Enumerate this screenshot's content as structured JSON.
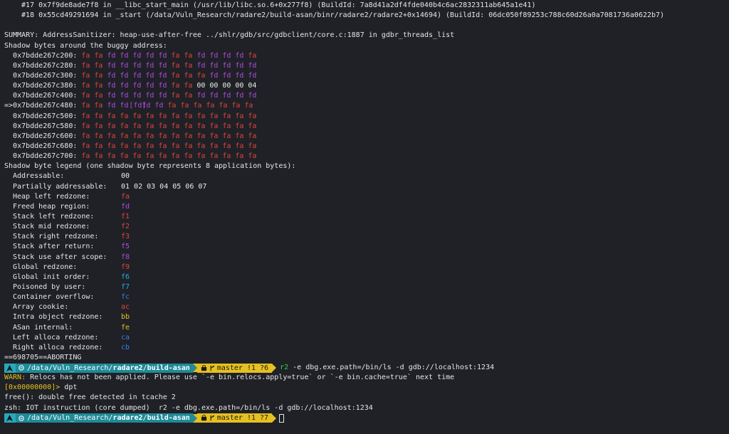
{
  "colors": {
    "background": "#1f2126",
    "heap_redzone": "#e0443e",
    "freed": "#b04be0",
    "prompt_os": "#2aa8b8",
    "prompt_path": "#1f8a98",
    "prompt_git": "#e6c020",
    "cmd_green": "#3fcf5a"
  },
  "backtrace": [
    "#17 0x7f9de8ade7f8 in __libc_start_main (/usr/lib/libc.so.6+0x277f8) (BuildId: 7a8d41a2df4fde040b4c6ac2832311ab645a1e41)",
    "#18 0x55cd49291694 in _start (/data/Vuln_Research/radare2/build-asan/binr/radare2/radare2+0x14694) (BuildId: 06dc050f89253c788c60d26a0a7081736a0622b7)"
  ],
  "summary": "SUMMARY: AddressSanitizer: heap-use-after-free ../shlr/gdb/src/gdbclient/core.c:1887 in gdbr_threads_list",
  "shadow_header": "Shadow bytes around the buggy address:",
  "shadow_rows": [
    {
      "prefix": "  ",
      "addr": "0x7bdde267c200:",
      "bytes": [
        "fa",
        "fa",
        "fd",
        "fd",
        "fd",
        "fd",
        "fd",
        "fa",
        "fa",
        "fd",
        "fd",
        "fd",
        "fd",
        "fa"
      ]
    },
    {
      "prefix": "  ",
      "addr": "0x7bdde267c280:",
      "bytes": [
        "fa",
        "fa",
        "fd",
        "fd",
        "fd",
        "fd",
        "fd",
        "fa",
        "fa",
        "fd",
        "fd",
        "fd",
        "fd",
        "fd"
      ]
    },
    {
      "prefix": "  ",
      "addr": "0x7bdde267c300:",
      "bytes": [
        "fa",
        "fa",
        "fd",
        "fd",
        "fd",
        "fd",
        "fd",
        "fa",
        "fa",
        "fa",
        "fd",
        "fd",
        "fd",
        "fd"
      ]
    },
    {
      "prefix": "  ",
      "addr": "0x7bdde267c380:",
      "bytes": [
        "fa",
        "fa",
        "fd",
        "fd",
        "fd",
        "fd",
        "fd",
        "fa",
        "fa",
        "00",
        "00",
        "00",
        "00",
        "04"
      ]
    },
    {
      "prefix": "  ",
      "addr": "0x7bdde267c400:",
      "bytes": [
        "fa",
        "fa",
        "fd",
        "fd",
        "fd",
        "fd",
        "fd",
        "fa",
        "fa",
        "fd",
        "fd",
        "fd",
        "fd",
        "fd"
      ]
    },
    {
      "prefix": "=>",
      "addr": "0x7bdde267c480:",
      "bytes": [
        "fa",
        "fa",
        "fd",
        "fd",
        "[fd]",
        "fd",
        "fd",
        "fa",
        "fa",
        "fa",
        "fa",
        "fa",
        "fa",
        "fa"
      ]
    },
    {
      "prefix": "  ",
      "addr": "0x7bdde267c500:",
      "bytes": [
        "fa",
        "fa",
        "fa",
        "fa",
        "fa",
        "fa",
        "fa",
        "fa",
        "fa",
        "fa",
        "fa",
        "fa",
        "fa",
        "fa"
      ]
    },
    {
      "prefix": "  ",
      "addr": "0x7bdde267c580:",
      "bytes": [
        "fa",
        "fa",
        "fa",
        "fa",
        "fa",
        "fa",
        "fa",
        "fa",
        "fa",
        "fa",
        "fa",
        "fa",
        "fa",
        "fa"
      ]
    },
    {
      "prefix": "  ",
      "addr": "0x7bdde267c600:",
      "bytes": [
        "fa",
        "fa",
        "fa",
        "fa",
        "fa",
        "fa",
        "fa",
        "fa",
        "fa",
        "fa",
        "fa",
        "fa",
        "fa",
        "fa"
      ]
    },
    {
      "prefix": "  ",
      "addr": "0x7bdde267c680:",
      "bytes": [
        "fa",
        "fa",
        "fa",
        "fa",
        "fa",
        "fa",
        "fa",
        "fa",
        "fa",
        "fa",
        "fa",
        "fa",
        "fa",
        "fa"
      ]
    },
    {
      "prefix": "  ",
      "addr": "0x7bdde267c700:",
      "bytes": [
        "fa",
        "fa",
        "fa",
        "fa",
        "fa",
        "fa",
        "fa",
        "fa",
        "fa",
        "fa",
        "fa",
        "fa",
        "fa",
        "fa"
      ]
    }
  ],
  "legend_header": "Shadow byte legend (one shadow byte represents 8 application bytes):",
  "legend": [
    {
      "label": "Addressable:",
      "value": "00",
      "cls": "c-00"
    },
    {
      "label": "Partially addressable:",
      "value": "01 02 03 04 05 06 07",
      "cls": "c-00"
    },
    {
      "label": "Heap left redzone:",
      "value": "fa",
      "cls": "c-fa"
    },
    {
      "label": "Freed heap region:",
      "value": "fd",
      "cls": "c-fd"
    },
    {
      "label": "Stack left redzone:",
      "value": "f1",
      "cls": "c-f1"
    },
    {
      "label": "Stack mid redzone:",
      "value": "f2",
      "cls": "c-f1"
    },
    {
      "label": "Stack right redzone:",
      "value": "f3",
      "cls": "c-f1"
    },
    {
      "label": "Stack after return:",
      "value": "f5",
      "cls": "c-f5"
    },
    {
      "label": "Stack use after scope:",
      "value": "f8",
      "cls": "c-f5"
    },
    {
      "label": "Global redzone:",
      "value": "f9",
      "cls": "c-f1"
    },
    {
      "label": "Global init order:",
      "value": "f6",
      "cls": "c-f6"
    },
    {
      "label": "Poisoned by user:",
      "value": "f7",
      "cls": "c-f7"
    },
    {
      "label": "Container overflow:",
      "value": "fc",
      "cls": "c-fc"
    },
    {
      "label": "Array cookie:",
      "value": "ac",
      "cls": "c-ac"
    },
    {
      "label": "Intra object redzone:",
      "value": "bb",
      "cls": "c-bb"
    },
    {
      "label": "ASan internal:",
      "value": "fe",
      "cls": "c-fe"
    },
    {
      "label": "Left alloca redzone:",
      "value": "ca",
      "cls": "c-ca"
    },
    {
      "label": "Right alloca redzone:",
      "value": "cb",
      "cls": "c-cb"
    }
  ],
  "aborting": "==698705==ABORTING",
  "prompt1": {
    "os_icon": "arch-linux-icon",
    "path_prefix": "/data/Vuln_Research/",
    "path_bold1": "radare2",
    "path_sep": "/",
    "path_bold2": "build-asan",
    "git": "master !1 ?6",
    "cmd_first": "r2",
    "cmd_rest": " -e dbg.exe.path=/bin/ls -d gdb://localhost:1234"
  },
  "warn_key": "WARN:",
  "warn_text": " Relocs has not been applied. Please use `-e bin.relocs.apply=true` or `-e bin.cache=true` next time",
  "r2_prompt_addr": "[0x00000000]>",
  "r2_cmd": " dpt",
  "free_msg": "free(): double free detected in tcache 2",
  "zsh_msg": "zsh: IOT instruction (core dumped)  r2 -e dbg.exe.path=/bin/ls -d gdb://localhost:1234",
  "prompt2": {
    "os_icon": "arch-linux-icon",
    "path_prefix": "/data/Vuln_Research/",
    "path_bold1": "radare2",
    "path_sep": "/",
    "path_bold2": "build-asan",
    "git": "master !1 ?7"
  }
}
